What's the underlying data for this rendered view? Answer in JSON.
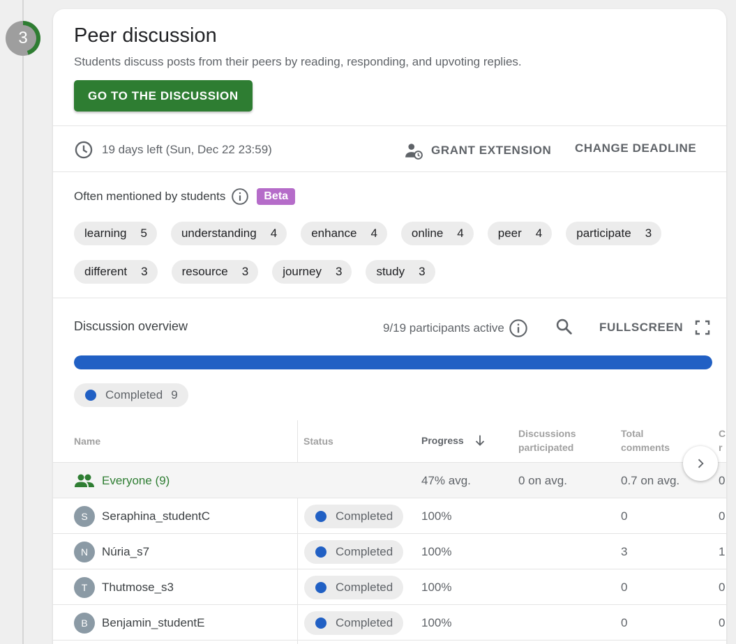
{
  "step": {
    "number": "3",
    "progress_fraction": 0.45,
    "done_color": "#2e7d32",
    "todo_color": "#9e9e9e"
  },
  "header": {
    "title": "Peer discussion",
    "description": "Students discuss posts from their peers by reading, responding, and upvoting replies.",
    "go_button": "GO TO THE DISCUSSION"
  },
  "deadline": {
    "icon": "clock-icon",
    "text": "19 days left (Sun, Dec 22 23:59)",
    "grant_extension": "GRANT EXTENSION",
    "change_deadline": "CHANGE DEADLINE"
  },
  "mentions": {
    "label": "Often mentioned by students",
    "badge": "Beta",
    "rows": [
      [
        {
          "word": "learning",
          "count": "5"
        },
        {
          "word": "understanding",
          "count": "4"
        },
        {
          "word": "enhance",
          "count": "4"
        },
        {
          "word": "online",
          "count": "4"
        },
        {
          "word": "peer",
          "count": "4"
        },
        {
          "word": "participate",
          "count": "3"
        }
      ],
      [
        {
          "word": "different",
          "count": "3"
        },
        {
          "word": "resource",
          "count": "3"
        },
        {
          "word": "journey",
          "count": "3"
        },
        {
          "word": "study",
          "count": "3"
        }
      ]
    ]
  },
  "overview": {
    "title": "Discussion overview",
    "active": "9/19 participants active",
    "fullscreen": "FULLSCREEN",
    "completed_fraction": 1.0,
    "bar_color": "#2160c4",
    "legend_label": "Completed",
    "legend_count": "9"
  },
  "table": {
    "columns": {
      "name": "Name",
      "status": "Status",
      "progress": "Progress",
      "disc1": "Discussions",
      "disc2": "participated",
      "total1": "Total",
      "total2": "comments",
      "cut1": "C",
      "cut2": "r"
    },
    "everyone": {
      "name": "Everyone (9)",
      "progress": "47% avg.",
      "discussions": "0 on avg.",
      "comments": "0.7 on avg.",
      "cut": "0"
    },
    "rows": [
      {
        "initial": "S",
        "name": "Seraphina_studentC",
        "status": "Completed",
        "progress": "100%",
        "comments": "0",
        "cut": "0"
      },
      {
        "initial": "N",
        "name": "Núria_s7",
        "status": "Completed",
        "progress": "100%",
        "comments": "3",
        "cut": "1"
      },
      {
        "initial": "T",
        "name": "Thutmose_s3",
        "status": "Completed",
        "progress": "100%",
        "comments": "0",
        "cut": "0"
      },
      {
        "initial": "B",
        "name": "Benjamin_studentE",
        "status": "Completed",
        "progress": "100%",
        "comments": "0",
        "cut": "0"
      }
    ]
  }
}
